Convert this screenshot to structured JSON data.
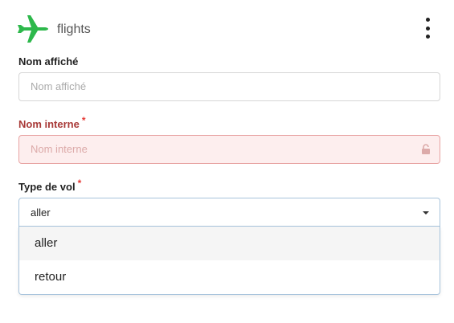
{
  "header": {
    "title": "flights",
    "icon": "airplane-icon",
    "icon_color": "#2db84b",
    "menu_icon": "more-vertical-icon"
  },
  "fields": {
    "display_name": {
      "label": "Nom affiché",
      "placeholder": "Nom affiché"
    },
    "internal_name": {
      "label": "Nom interne",
      "required_mark": "*",
      "placeholder": "Nom interne",
      "locked_icon": "lock-icon",
      "state": "error"
    },
    "flight_type": {
      "label": "Type de vol",
      "required_mark": "*",
      "value": "aller",
      "options": [
        "aller",
        "retour"
      ],
      "highlighted_option": "aller"
    }
  },
  "colors": {
    "accent": "#2db84b",
    "error_label": "#a93a38",
    "error_bg": "#fdeeee",
    "error_border": "#e8a4a3",
    "focus_border": "#a8c4dc"
  }
}
